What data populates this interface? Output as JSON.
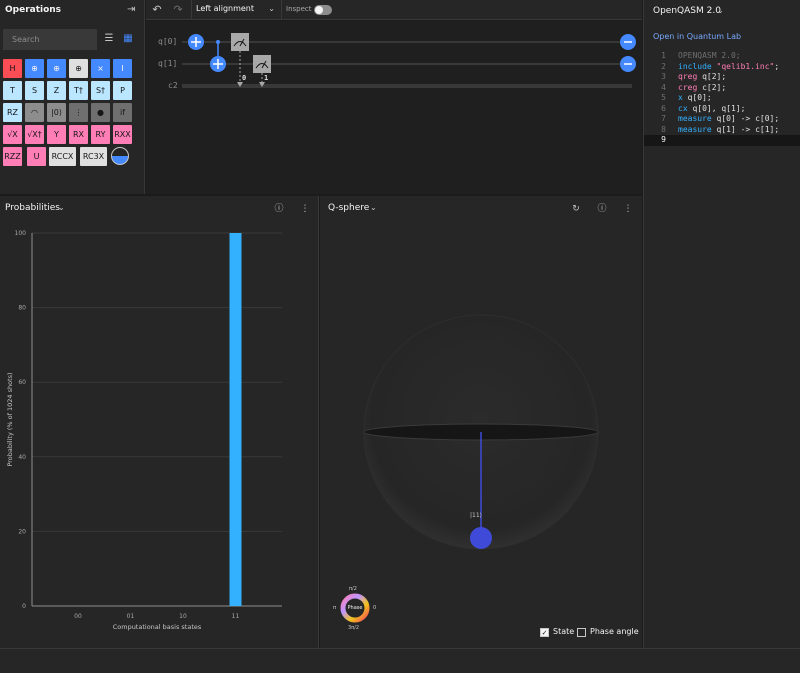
{
  "operations": {
    "title": "Operations",
    "search_placeholder": "Search",
    "gates": [
      {
        "label": "H",
        "style": "g-red"
      },
      {
        "label": "⊕",
        "style": "g-blue"
      },
      {
        "label": "⊕",
        "style": "g-blue"
      },
      {
        "label": "⊕",
        "style": "g-white"
      },
      {
        "label": "⨯",
        "style": "g-blue"
      },
      {
        "label": "I",
        "style": "g-blue"
      },
      {
        "label": "T",
        "style": "g-ltblue"
      },
      {
        "label": "S",
        "style": "g-ltblue"
      },
      {
        "label": "Z",
        "style": "g-ltblue"
      },
      {
        "label": "T†",
        "style": "g-ltblue"
      },
      {
        "label": "S†",
        "style": "g-ltblue"
      },
      {
        "label": "P",
        "style": "g-ltblue"
      },
      {
        "label": "RZ",
        "style": "g-ltblue"
      },
      {
        "label": "◠",
        "style": "g-gray"
      },
      {
        "label": "|0⟩",
        "style": "g-gray"
      },
      {
        "label": "⋮",
        "style": "g-dgray"
      },
      {
        "label": "●",
        "style": "g-dgray"
      },
      {
        "label": "if",
        "style": "g-dgray"
      },
      {
        "label": "√X",
        "style": "g-pink"
      },
      {
        "label": "√X†",
        "style": "g-pink"
      },
      {
        "label": "Y",
        "style": "g-pink"
      },
      {
        "label": "RX",
        "style": "g-pink"
      },
      {
        "label": "RY",
        "style": "g-pink"
      },
      {
        "label": "RXX",
        "style": "g-pink"
      },
      {
        "label": "RZZ",
        "style": "g-pink"
      },
      {
        "label": "U",
        "style": "g-pink"
      },
      {
        "label": "RCCX",
        "style": "g-white"
      },
      {
        "label": "RC3X",
        "style": "g-white"
      }
    ]
  },
  "toolbar": {
    "alignment": "Left alignment",
    "inspect_label": "Inspect"
  },
  "circuit": {
    "qubits": [
      "q[0]",
      "q[1]"
    ],
    "classical": "c2",
    "measure_indices": [
      "0",
      "1"
    ]
  },
  "qasm": {
    "title": "OpenQASM 2.0",
    "link": "Open in Quantum Lab",
    "lines": [
      {
        "n": "1",
        "code": [
          {
            "t": "OPENQASM 2.0;",
            "c": "#6f6f6f"
          }
        ]
      },
      {
        "n": "2",
        "code": [
          {
            "t": "include ",
            "c": "#33b1ff"
          },
          {
            "t": "\"qelib1.inc\"",
            "c": "#ff7eb6"
          },
          {
            "t": ";",
            "c": "#e0e0e0"
          }
        ]
      },
      {
        "n": "3",
        "code": [
          {
            "t": "qreg ",
            "c": "#ff7eb6"
          },
          {
            "t": "q[2];",
            "c": "#e0e0e0"
          }
        ]
      },
      {
        "n": "4",
        "code": [
          {
            "t": "creg ",
            "c": "#ff7eb6"
          },
          {
            "t": "c[2];",
            "c": "#e0e0e0"
          }
        ]
      },
      {
        "n": "5",
        "code": [
          {
            "t": "x ",
            "c": "#33b1ff"
          },
          {
            "t": "q[0];",
            "c": "#e0e0e0"
          }
        ]
      },
      {
        "n": "6",
        "code": [
          {
            "t": "cx ",
            "c": "#33b1ff"
          },
          {
            "t": "q[0], q[1];",
            "c": "#e0e0e0"
          }
        ]
      },
      {
        "n": "7",
        "code": [
          {
            "t": "measure ",
            "c": "#33b1ff"
          },
          {
            "t": "q[0] -> c[0];",
            "c": "#e0e0e0"
          }
        ]
      },
      {
        "n": "8",
        "code": [
          {
            "t": "measure ",
            "c": "#33b1ff"
          },
          {
            "t": "q[1] -> c[1];",
            "c": "#e0e0e0"
          }
        ]
      },
      {
        "n": "9",
        "code": []
      }
    ]
  },
  "probabilities": {
    "title": "Probabilities",
    "chart_data": {
      "type": "bar",
      "categories": [
        "00",
        "01",
        "10",
        "11"
      ],
      "values": [
        0,
        0,
        0,
        100
      ],
      "xlabel": "Computational basis states",
      "ylabel": "Probability (% of 1024 shots)",
      "ylim": [
        0,
        100
      ],
      "yticks": [
        "0",
        "20",
        "40",
        "60",
        "80",
        "100"
      ],
      "grid": true,
      "bar_color": "#33b1ff"
    }
  },
  "qsphere": {
    "title": "Q-sphere",
    "state_label": "|11⟩",
    "phase_wheel": {
      "center": "Phase",
      "top": "π/2",
      "left": "π",
      "right": "0",
      "bottom": "3π/2"
    },
    "state_checkbox": "State",
    "phase_checkbox": "Phase angle",
    "state_color": "#3f4bd8"
  }
}
